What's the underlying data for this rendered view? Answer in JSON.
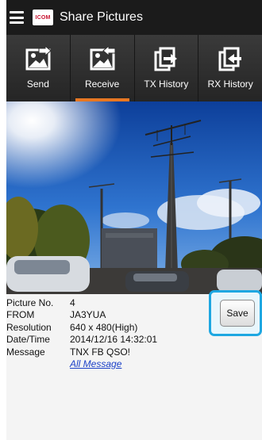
{
  "app": {
    "title": "Share Pictures",
    "logo_text": "ICOM",
    "accent_color": "#e87722",
    "highlight_color": "#1ea7e1"
  },
  "tabs": [
    {
      "label": "Send",
      "icon": "image-send-icon",
      "selected": false
    },
    {
      "label": "Receive",
      "icon": "image-receive-icon",
      "selected": true
    },
    {
      "label": "TX History",
      "icon": "tx-history-icon",
      "selected": false
    },
    {
      "label": "RX History",
      "icon": "rx-history-icon",
      "selected": false
    }
  ],
  "picture_info": {
    "picture_no_label": "Picture No.",
    "picture_no": "4",
    "from_label": "FROM",
    "from": "JA3YUA",
    "resolution_label": "Resolution",
    "resolution": "640 x 480(High)",
    "datetime_label": "Date/Time",
    "datetime": "2014/12/16 14:32:01",
    "message_label": "Message",
    "message": "TNX FB QSO!",
    "all_message_link": "All Message"
  },
  "save_button": {
    "label": "Save"
  }
}
